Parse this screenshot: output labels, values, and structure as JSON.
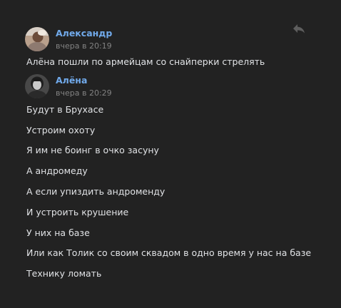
{
  "messages": [
    {
      "author": "Александр",
      "time": "вчера в 20:19",
      "lines": [
        "Алёна пошли по армейцам со снайперки стрелять"
      ]
    },
    {
      "author": "Алёна",
      "time": "вчера в 20:29",
      "lines": [
        "Будут в Брухасе",
        "Устроим охоту",
        "Я им не боинг в очко засуну",
        "А андромеду",
        "А если упиздить андроменду",
        "И устроить крушение",
        "У них на базе",
        "Или как Толик со своим сквадом в одно время у нас на базе",
        "Технику ломать"
      ]
    }
  ],
  "icons": {
    "reply": "reply-icon"
  },
  "colors": {
    "background": "#222222",
    "author_link": "#71aaeb",
    "timestamp": "#828282",
    "text": "#e1e3e6",
    "icon": "#5e5e5e"
  }
}
